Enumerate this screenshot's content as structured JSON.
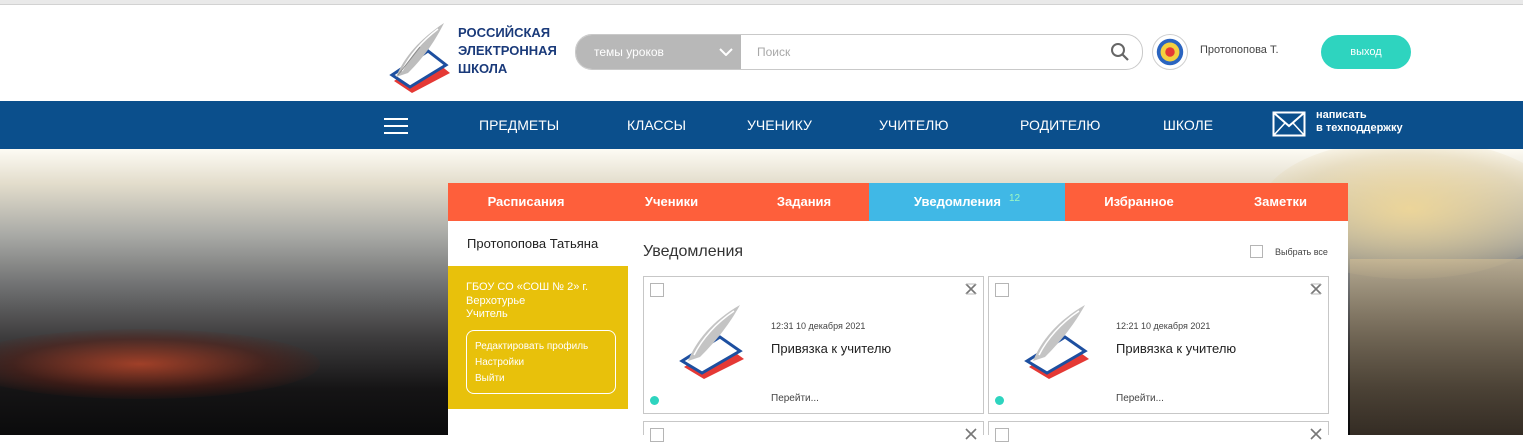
{
  "header": {
    "logo_lines": [
      "РОССИЙСКАЯ",
      "ЭЛЕКТРОННАЯ",
      "ШКОЛА"
    ],
    "search": {
      "category": "темы уроков",
      "placeholder": "Поиск"
    },
    "user_name": "Протопопова Т.",
    "exit_label": "выход"
  },
  "nav": {
    "items": [
      "ПРЕДМЕТЫ",
      "КЛАССЫ",
      "УЧЕНИКУ",
      "УЧИТЕЛЮ",
      "РОДИТЕЛЮ",
      "ШКОЛЕ"
    ],
    "support_line1": "написать",
    "support_line2": "в техподдержку"
  },
  "tabs": [
    {
      "label": "Расписания"
    },
    {
      "label": "Ученики"
    },
    {
      "label": "Задания"
    },
    {
      "label": "Уведомления",
      "badge": "12",
      "active": true
    },
    {
      "label": "Избранное"
    },
    {
      "label": "Заметки"
    }
  ],
  "sidebar": {
    "name": "Протопопова Татьяна",
    "school": "ГБОУ СО «СОШ № 2» г. Верхотурье",
    "role": "Учитель",
    "links": [
      "Редактировать профиль",
      "Настройки",
      "Выйти"
    ]
  },
  "notifications": {
    "title": "Уведомления",
    "select_all": "Выбрать все",
    "items": [
      {
        "time": "12:31 10 декабря 2021",
        "title": "Привязка к учителю",
        "link": "Перейти...",
        "unread": true
      },
      {
        "time": "12:21 10 декабря 2021",
        "title": "Привязка к учителю",
        "link": "Перейти...",
        "unread": true
      }
    ]
  },
  "colors": {
    "nav_bg": "#0b4f8c",
    "tab_bg": "#fe5f3b",
    "tab_active": "#40b8e6",
    "profile_bg": "#e8c10b",
    "accent": "#2ed4bf"
  }
}
